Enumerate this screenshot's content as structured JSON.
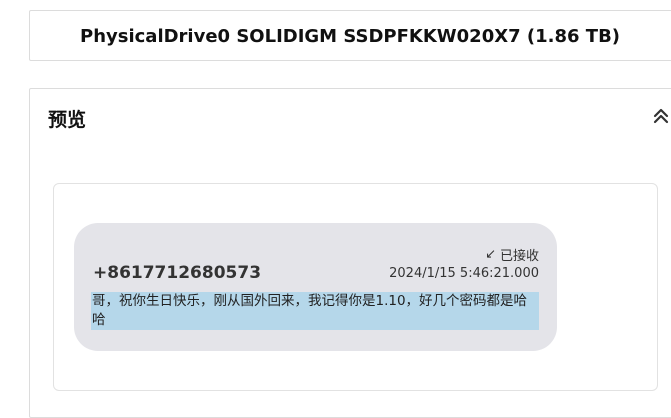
{
  "drive": {
    "title": "PhysicalDrive0 SOLIDIGM SSDPFKKW020X7 (1.86 TB)"
  },
  "preview": {
    "title": "预览",
    "collapse_icon": "double-chevron-up-icon"
  },
  "message": {
    "status_icon": "received-arrow-icon",
    "status": "已接收",
    "sender": "+8617712680573",
    "timestamp": "2024/1/15 5:46:21.000",
    "body": "哥，祝你生日快乐，刚从国外回来，我记得你是1.10，好几个密码都是哈哈",
    "selection_color": "#b5d7ea",
    "bubble_color": "#e4e4e9"
  }
}
